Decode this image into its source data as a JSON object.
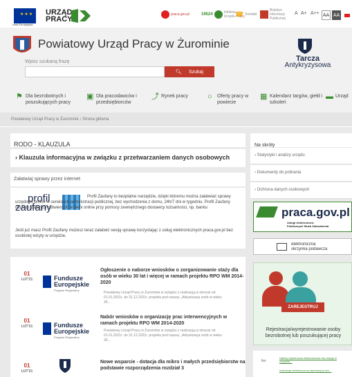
{
  "topbar": {
    "eu_label": "Unia Europejska",
    "up_line1": "URZĄD",
    "up_line2": "PRACY",
    "praca_gov": "praca.gov.pl",
    "infolinia_num": "19524",
    "infolinia_label": "Infolinia Urzędu Pracy",
    "kontakt": "Kontakt",
    "bip_label": "Biuletyn Informacji Publicznej",
    "font_sizes": [
      "A",
      "A+",
      "A++"
    ],
    "contrast": [
      "AA",
      "AA"
    ]
  },
  "header": {
    "title": "Powiatowy Urząd Pracy w Żurominie",
    "search_label": "Wpisz szukaną frazę",
    "search_placeholder": "",
    "search_button": "Szukaj",
    "tarcza_line1": "Tarcza",
    "tarcza_line2": "Antykryzysowa"
  },
  "nav": [
    {
      "label": "Dla bezrobotnych i poszukujących pracy",
      "icon": "signpost-icon"
    },
    {
      "label": "Dla pracodawców i przedsiębiorców",
      "icon": "briefcase-icon"
    },
    {
      "label": "Rynek pracy",
      "icon": "chart-icon"
    },
    {
      "label": "Oferty pracy w powiecie",
      "icon": "search-icon"
    },
    {
      "label": "Kalendarz targów, giełd i szkoleń",
      "icon": "calendar-icon"
    },
    {
      "label": "Urząd",
      "icon": "building-icon"
    }
  ],
  "breadcrumb": {
    "home": "Powiatowy Urząd Pracy w Żurominie",
    "sep": "›",
    "current": "Strona główna"
  },
  "rodo": {
    "title": "RODO - KLAUZULA",
    "item": "Klauzula informacyjna w związku z przetwarzaniem danych osobowych"
  },
  "profil": {
    "heading": "Załatwiaj sprawy przez internet",
    "logo_line1": "profil",
    "logo_line2": "zaufany",
    "text": "Profil Zaufany to bezpłatne narzędzie, dzięki któremu można załatwiać sprawy urzędowe online w serwisach administracji publicznej, bez wychodzenia z domu, 24h/7 dni w tygodniu. Profil Zaufany możesz założyć i potwierdzić w pełni online przy pomocy zewnętrznego dostawcy tożsamości, np. banku",
    "text2": "Jeśli już masz Profil Zaufany możesz teraz załatwić swoją sprawę korzystając z usług elektronicznych praca.gov.pl bez osobistej wizyty w urzędzie."
  },
  "news": [
    {
      "day": "01",
      "month": "LUT'21",
      "title": "Ogłoszenie o naborze wniosków o zorganizowanie staży dla osób w wieku 30 lat i więcej w ramach projektu RPO WM 2014-2020",
      "excerpt": "Powiatowy Urząd Pracy w Żurominie w związku z realizacją w okresie od 01.01.2021r. do 31.12.2021r. projektu pod nazwą: „Aktywizacja osób w wieku 30..."
    },
    {
      "day": "01",
      "month": "LUT'21",
      "title": "Nabór wniosków o organizację prac interwencyjnych w ramach projektu RPO WM 2014-2020",
      "excerpt": "Powiatowy Urząd Pracy w Żurominie w związku z realizacją w okresie od 01.01.2021r. do 31.12.2021r. projektu pod nazwą: „Aktywizacja osób w wieku 30..."
    },
    {
      "day": "01",
      "month": "LUT'21",
      "title": "Nowe wsparcie - dotacja dla mikro i małych przedsiębiorstw na podstawie rozporządzenia rozdział 3",
      "excerpt": ""
    }
  ],
  "fundusze": {
    "line1": "Fundusze",
    "line2": "Europejskie",
    "sub": "Program Regionalny"
  },
  "sidebar": {
    "heading": "Na skróty",
    "items": [
      "Statystyki i analizy urzędu",
      "Dokumenty do pobrania",
      "Ochrona danych osobowych"
    ],
    "praca_logo": "praca.gov.pl",
    "praca_sub1": "Usługi elektroniczne",
    "praca_sub2": "Publicznych Służb Zatrudnienia",
    "skrzynka": "elektroniczna skrzynka podawcza",
    "register_btn": "ZAREJESTRUJ",
    "register_text": "Rejestracja/wyrejestrowanie osoby bezrobotnej lub poszukującej pracy",
    "table_label": "Ikn",
    "link1": "Należy rejestrować elektronicznie bez wizyty w urzędzie...",
    "link2": "Instrukcja elektronicznej rejestracji przez..."
  },
  "colors": {
    "accent": "#c0392b",
    "green": "#3a8b2f",
    "navy": "#1b2a4a"
  }
}
